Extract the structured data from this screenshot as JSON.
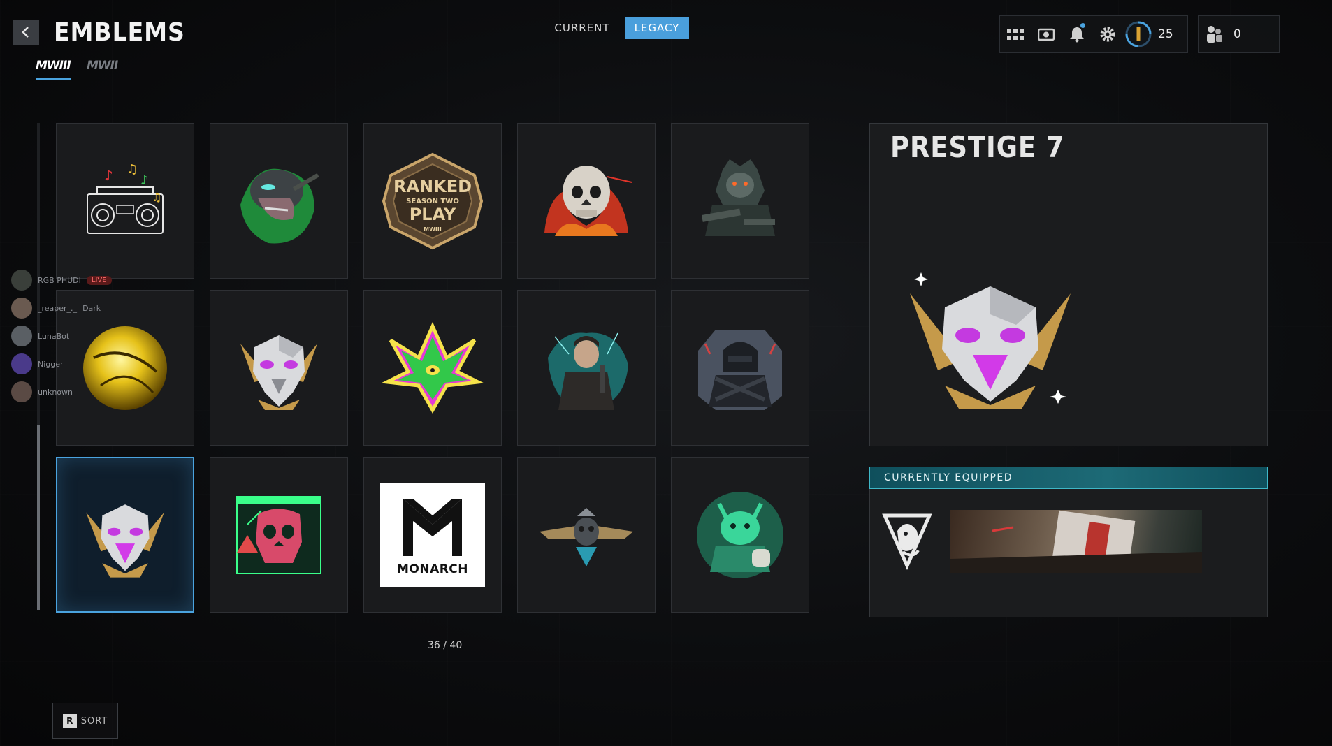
{
  "header": {
    "title": "EMBLEMS",
    "game_tabs": [
      {
        "label": "MWIII",
        "active": true
      },
      {
        "label": "MWII",
        "active": false
      }
    ],
    "segments": [
      {
        "label": "CURRENT",
        "active": false
      },
      {
        "label": "LEGACY",
        "active": true
      }
    ]
  },
  "hud": {
    "icons": [
      "grid-icon",
      "camera-icon",
      "bell-icon",
      "gear-icon",
      "prestige-icon"
    ],
    "level": "25",
    "party_count": "0",
    "accent_color": "#4a9fdc"
  },
  "grid": {
    "counter": "36 / 40",
    "tiles": [
      {
        "icon": "boombox-emblem"
      },
      {
        "icon": "zombie-soldier-emblem"
      },
      {
        "icon": "ranked-play-emblem",
        "text_lines": [
          "RANKED",
          "SEASON TWO",
          "PLAY",
          "MWIII"
        ]
      },
      {
        "icon": "skull-fire-emblem"
      },
      {
        "icon": "armored-soldier-emblem"
      },
      {
        "icon": "golden-orb-emblem"
      },
      {
        "icon": "eagle-silver-emblem"
      },
      {
        "icon": "neon-leaf-emblem"
      },
      {
        "icon": "gunman-emblem"
      },
      {
        "icon": "hooded-operator-emblem"
      },
      {
        "icon": "prestige-7-eagle-emblem",
        "selected": true
      },
      {
        "icon": "cyber-skull-emblem"
      },
      {
        "icon": "monarch-emblem",
        "label": "MONARCH"
      },
      {
        "icon": "winged-skull-emblem"
      },
      {
        "icon": "green-demon-emblem"
      }
    ]
  },
  "detail": {
    "title": "PRESTIGE 7",
    "equipped_header": "CURRENTLY EQUIPPED"
  },
  "footer": {
    "sort_key": "R",
    "sort_label": "SORT"
  },
  "social": [
    {
      "name": "RGB PHUDI",
      "badge": "LIVE"
    },
    {
      "name": "_reaper_._",
      "status": "Dark"
    },
    {
      "name": "LunaBot"
    },
    {
      "name": "Nigger"
    },
    {
      "name": "unknown"
    }
  ]
}
